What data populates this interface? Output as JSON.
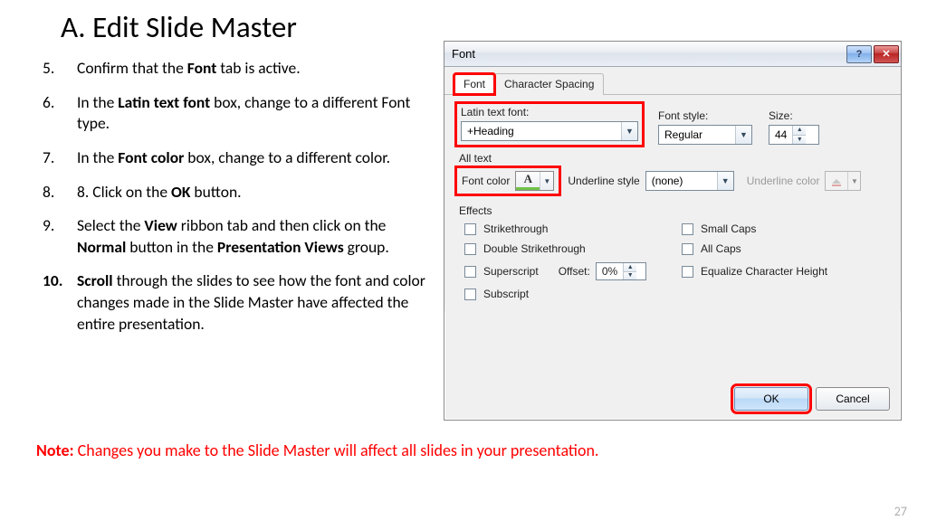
{
  "page_title": "A. Edit Slide Master",
  "steps": [
    {
      "n": "5.",
      "html": "Confirm that the <b>Font</b> tab is active."
    },
    {
      "n": "6.",
      "html": "In the <b>Latin text font</b> box, change to a different Font type."
    },
    {
      "n": "7.",
      "html": "In the <b>Font color</b> box, change to a different color."
    },
    {
      "n": "8.",
      "html": "8. Click on the <b>OK</b> button."
    },
    {
      "n": "9.",
      "html": "Select the <b>View</b> ribbon tab and then click on the <b>Normal</b> button in the <b>Presentation Views</b> group."
    },
    {
      "n": "10.",
      "bold_num": true,
      "html": "<b>Scroll</b> through the slides to see how the font and color changes made in the Slide Master have affected the entire presentation."
    }
  ],
  "note": {
    "label": "Note: ",
    "body": "Changes you make to the Slide Master will affect all slides in your presentation."
  },
  "page_number": "27",
  "dialog": {
    "title": "Font",
    "help": "?",
    "close": "✕",
    "tabs": {
      "font": "Font",
      "char_spacing": "Character Spacing"
    },
    "latin_label": "Latin text font:",
    "latin_value": "+Heading",
    "style_label": "Font style:",
    "style_value": "Regular",
    "size_label": "Size:",
    "size_value": "44",
    "alltext_label": "All text",
    "font_color_label": "Font color",
    "font_color_glyph": "A",
    "ulstyle_label": "Underline style",
    "ulstyle_value": "(none)",
    "ulcolor_label": "Underline color",
    "effects_label": "Effects",
    "effects": {
      "strike": "Strikethrough",
      "dstrike": "Double Strikethrough",
      "superscript": "Superscript",
      "subscript": "Subscript",
      "smallcaps": "Small Caps",
      "allcaps": "All Caps",
      "eqheight": "Equalize Character Height"
    },
    "offset_label": "Offset:",
    "offset_value": "0%",
    "ok": "OK",
    "cancel": "Cancel"
  }
}
